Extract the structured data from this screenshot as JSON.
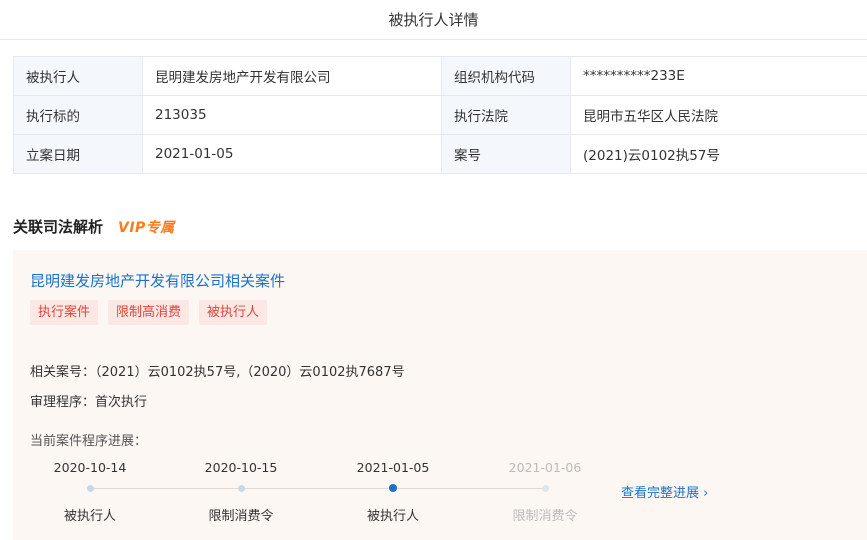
{
  "header": {
    "title": "被执行人详情"
  },
  "info": {
    "rows": [
      {
        "l1": "被执行人",
        "v1": "昆明建发房地产开发有限公司",
        "l2": "组织机构代码",
        "v2": "**********233E"
      },
      {
        "l1": "执行标的",
        "v1": "213035",
        "l2": "执行法院",
        "v2": "昆明市五华区人民法院"
      },
      {
        "l1": "立案日期",
        "v1": "2021-01-05",
        "l2": "案号",
        "v2": "(2021)云0102执57号"
      }
    ]
  },
  "section": {
    "title": "关联司法解析",
    "vip": "VIP专属"
  },
  "case": {
    "title": "昆明建发房地产开发有限公司相关案件",
    "tags": [
      "执行案件",
      "限制高消费",
      "被执行人"
    ],
    "related": "相关案号：（2021）云0102执57号,（2020）云0102执7687号",
    "procedure": "审理程序：首次执行",
    "progress_label": "当前案件程序进展：",
    "timeline": [
      {
        "date": "2020-10-14",
        "label": "被执行人"
      },
      {
        "date": "2020-10-15",
        "label": "限制消费令"
      },
      {
        "date": "2021-01-05",
        "label": "被执行人"
      },
      {
        "date": "2021-01-06",
        "label": "限制消费令"
      }
    ],
    "full_link": "查看完整进展 ›"
  }
}
